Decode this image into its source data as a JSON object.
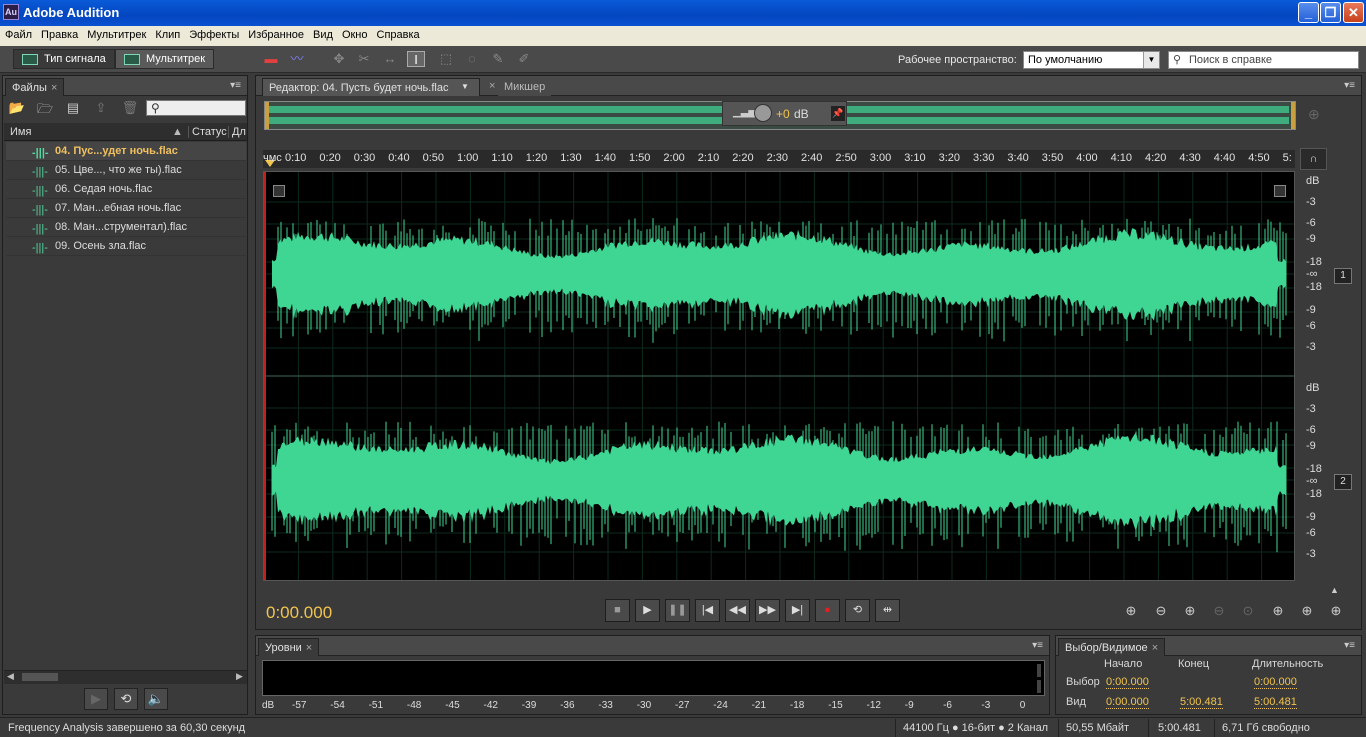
{
  "window": {
    "title": "Adobe Audition",
    "app_badge": "Au"
  },
  "menu": [
    "Файл",
    "Правка",
    "Мультитрек",
    "Клип",
    "Эффекты",
    "Избранное",
    "Вид",
    "Окно",
    "Справка"
  ],
  "toolbar": {
    "mode_waveform": "Тип сигнала",
    "mode_multitrack": "Мультитрек",
    "workspace_label": "Рабочее пространство:",
    "workspace_value": "По умолчанию",
    "search_placeholder": "Поиск в справке"
  },
  "files_panel": {
    "tab": "Файлы",
    "col_name": "Имя",
    "col_status": "Статус",
    "col_dur": "Дл",
    "items": [
      {
        "name": "04. Пус...удет ночь.flac",
        "active": true
      },
      {
        "name": "05. Цве..., что же ты).flac"
      },
      {
        "name": "06. Седая ночь.flac"
      },
      {
        "name": "07. Ман...ебная ночь.flac"
      },
      {
        "name": "08. Ман...струментал).flac"
      },
      {
        "name": "09. Осень зла.flac"
      }
    ]
  },
  "editor": {
    "tab_editor": "Редактор: 04. Пусть будет ночь.flac",
    "tab_mixer": "Микшер",
    "hud_gain": "+0",
    "hud_unit": "dB",
    "timecode": "0:00.000",
    "ruler_unit": "чмс",
    "ruler_ticks": [
      "0:10",
      "0:20",
      "0:30",
      "0:40",
      "0:50",
      "1:00",
      "1:10",
      "1:20",
      "1:30",
      "1:40",
      "1:50",
      "2:00",
      "2:10",
      "2:20",
      "2:30",
      "2:40",
      "2:50",
      "3:00",
      "3:10",
      "3:20",
      "3:30",
      "3:40",
      "3:50",
      "4:00",
      "4:10",
      "4:20",
      "4:30",
      "4:40",
      "4:50",
      "5:"
    ],
    "db_labels_ch1": [
      "dB",
      "-3",
      "-6",
      "-9",
      "-18",
      "-∞",
      "-18",
      "-9",
      "-6",
      "-3"
    ],
    "db_labels_ch2": [
      "dB",
      "-3",
      "-6",
      "-9",
      "-18",
      "-∞",
      "-18",
      "-9",
      "-6",
      "-3"
    ],
    "channel_1": "1",
    "channel_2": "2",
    "waveform_color": "#3fd694"
  },
  "levels_panel": {
    "tab": "Уровни",
    "scale": [
      "dB",
      "-57",
      "-54",
      "-51",
      "-48",
      "-45",
      "-42",
      "-39",
      "-36",
      "-33",
      "-30",
      "-27",
      "-24",
      "-21",
      "-18",
      "-15",
      "-12",
      "-9",
      "-6",
      "-3",
      "0"
    ]
  },
  "selview_panel": {
    "tab": "Выбор/Видимое",
    "col_start": "Начало",
    "col_end": "Конец",
    "col_dur": "Длительность",
    "row_sel": "Выбор",
    "row_view": "Вид",
    "sel_start": "0:00.000",
    "sel_end": "",
    "sel_dur": "0:00.000",
    "view_start": "0:00.000",
    "view_end": "5:00.481",
    "view_dur": "5:00.481"
  },
  "status": {
    "message": "Frequency Analysis завершено за 60,30 секунд",
    "format": "44100 Гц ● 16-бит ● 2 Канал",
    "size": "50,55 Мбайт",
    "duration": "5:00.481",
    "free": "6,71 Гб свободно"
  }
}
